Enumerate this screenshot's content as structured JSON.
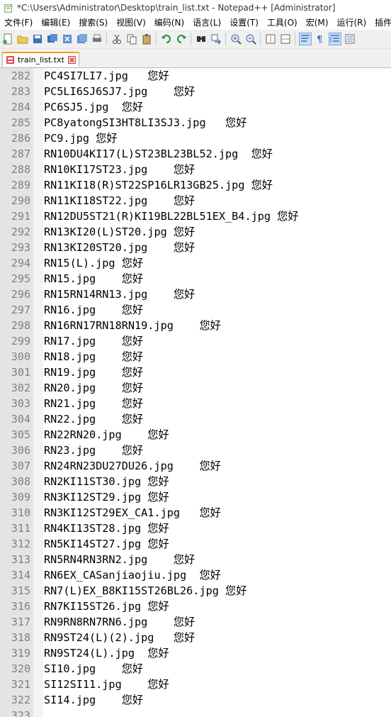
{
  "window": {
    "title": "*C:\\Users\\Administrator\\Desktop\\train_list.txt - Notepad++ [Administrator]"
  },
  "menu": [
    "文件(F)",
    "编辑(E)",
    "搜索(S)",
    "视图(V)",
    "编码(N)",
    "语言(L)",
    "设置(T)",
    "工具(O)",
    "宏(M)",
    "运行(R)",
    "插件"
  ],
  "toolbar": {
    "icons": [
      "new-file-icon",
      "open-file-icon",
      "save-icon",
      "save-all-icon",
      "close-file-icon",
      "close-all-icon",
      "print-icon",
      "|",
      "cut-icon",
      "copy-icon",
      "paste-icon",
      "|",
      "undo-icon",
      "redo-icon",
      "|",
      "find-icon",
      "replace-icon",
      "|",
      "zoom-in-icon",
      "zoom-out-icon",
      "|",
      "sync-vertical-icon",
      "sync-horizontal-icon",
      "|",
      "word-wrap-icon",
      "show-all-chars-icon",
      "indent-guide-icon",
      "function-list-icon"
    ]
  },
  "tab": {
    "label": "train_list.txt"
  },
  "colors": {
    "modified_tab_icon": "#e34b4b",
    "gutter": "#e4e4e4",
    "line_number": "#7f7f7f",
    "tab_accent": "#f6a000"
  },
  "editor": {
    "lines": [
      {
        "n": "282",
        "text": "PC4SI7LI7.jpg   您好"
      },
      {
        "n": "283",
        "text": "PC5LI6SJ6SJ7.jpg    您好"
      },
      {
        "n": "284",
        "text": "PC6SJ5.jpg  您好"
      },
      {
        "n": "285",
        "text": "PC8yatongSI3HT8LI3SJ3.jpg   您好"
      },
      {
        "n": "286",
        "text": "PC9.jpg 您好"
      },
      {
        "n": "287",
        "text": "RN10DU4KI17(L)ST23BL23BL52.jpg  您好"
      },
      {
        "n": "288",
        "text": "RN10KI17ST23.jpg    您好"
      },
      {
        "n": "289",
        "text": "RN11KI18(R)ST22SP16LR13GB25.jpg 您好"
      },
      {
        "n": "290",
        "text": "RN11KI18ST22.jpg    您好"
      },
      {
        "n": "291",
        "text": "RN12DU5ST21(R)KI19BL22BL51EX_B4.jpg 您好"
      },
      {
        "n": "292",
        "text": "RN13KI20(L)ST20.jpg 您好"
      },
      {
        "n": "293",
        "text": "RN13KI20ST20.jpg    您好"
      },
      {
        "n": "294",
        "text": "RN15(L).jpg 您好"
      },
      {
        "n": "295",
        "text": "RN15.jpg    您好"
      },
      {
        "n": "296",
        "text": "RN15RN14RN13.jpg    您好"
      },
      {
        "n": "297",
        "text": "RN16.jpg    您好"
      },
      {
        "n": "298",
        "text": "RN16RN17RN18RN19.jpg    您好"
      },
      {
        "n": "299",
        "text": "RN17.jpg    您好"
      },
      {
        "n": "300",
        "text": "RN18.jpg    您好"
      },
      {
        "n": "301",
        "text": "RN19.jpg    您好"
      },
      {
        "n": "302",
        "text": "RN20.jpg    您好"
      },
      {
        "n": "303",
        "text": "RN21.jpg    您好"
      },
      {
        "n": "304",
        "text": "RN22.jpg    您好"
      },
      {
        "n": "305",
        "text": "RN22RN20.jpg    您好"
      },
      {
        "n": "306",
        "text": "RN23.jpg    您好"
      },
      {
        "n": "307",
        "text": "RN24RN23DU27DU26.jpg    您好"
      },
      {
        "n": "308",
        "text": "RN2KI11ST30.jpg 您好"
      },
      {
        "n": "309",
        "text": "RN3KI12ST29.jpg 您好"
      },
      {
        "n": "310",
        "text": "RN3KI12ST29EX_CA1.jpg   您好"
      },
      {
        "n": "311",
        "text": "RN4KI13ST28.jpg 您好"
      },
      {
        "n": "312",
        "text": "RN5KI14ST27.jpg 您好"
      },
      {
        "n": "313",
        "text": "RN5RN4RN3RN2.jpg    您好"
      },
      {
        "n": "314",
        "text": "RN6EX_CASanjiaojiu.jpg  您好"
      },
      {
        "n": "315",
        "text": "RN7(L)EX_B8KI15ST26BL26.jpg 您好"
      },
      {
        "n": "316",
        "text": "RN7KI15ST26.jpg 您好"
      },
      {
        "n": "317",
        "text": "RN9RN8RN7RN6.jpg    您好"
      },
      {
        "n": "318",
        "text": "RN9ST24(L)(2).jpg   您好"
      },
      {
        "n": "319",
        "text": "RN9ST24(L).jpg  您好"
      },
      {
        "n": "320",
        "text": "SI10.jpg    您好"
      },
      {
        "n": "321",
        "text": "SI12SI11.jpg    您好"
      },
      {
        "n": "322",
        "text": "SI14.jpg    您好"
      },
      {
        "n": "323",
        "text": ""
      }
    ]
  }
}
